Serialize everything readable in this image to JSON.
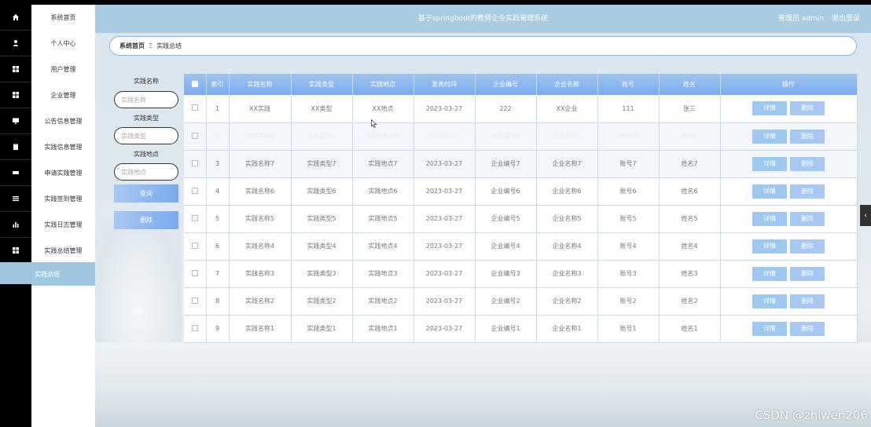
{
  "header": {
    "title": "基于springboot的教师企业实践管理系统",
    "user": "管理员 admin",
    "logout": "退出登录"
  },
  "breadcrumb": {
    "home": "系统首页",
    "separator": "Ξ",
    "current": "实践总结"
  },
  "sidebar": {
    "items": [
      {
        "label": "系统首页",
        "icon": "home-icon"
      },
      {
        "label": "个人中心",
        "icon": "user-icon"
      },
      {
        "label": "用户管理",
        "icon": "grid-icon"
      },
      {
        "label": "企业管理",
        "icon": "grid-icon"
      },
      {
        "label": "公告信息管理",
        "icon": "monitor-icon"
      },
      {
        "label": "实践信息管理",
        "icon": "clipboard-icon"
      },
      {
        "label": "申请实践管理",
        "icon": "ticket-icon"
      },
      {
        "label": "实践签到管理",
        "icon": "list-icon"
      },
      {
        "label": "实践日志管理",
        "icon": "bar-chart-icon"
      },
      {
        "label": "实践总结管理",
        "icon": "grid-icon"
      }
    ],
    "active": {
      "label": "实践总结"
    }
  },
  "filters": {
    "name_label": "实践名称",
    "name_placeholder": "实践名称",
    "type_label": "实践类型",
    "type_placeholder": "实践类型",
    "place_label": "实践地点",
    "place_placeholder": "实践地点",
    "query_button": "查询",
    "delete_button": "删除"
  },
  "table": {
    "columns": [
      "索引",
      "实践名称",
      "实践类型",
      "实践地点",
      "发表时间",
      "企业编号",
      "企业名称",
      "账号",
      "姓名",
      "操作"
    ],
    "detail_label": "详情",
    "delete_label": "删除",
    "rows": [
      {
        "index": "1",
        "name": "XX实践",
        "type": "XX类型",
        "place": "XX地点",
        "time": "2023-03-27",
        "company_no": "222",
        "company": "XX企业",
        "account": "111",
        "person": "张三"
      },
      {
        "index": "2",
        "name": "实践名称8",
        "type": "实践类型8",
        "place": "实践地点8",
        "time": "2023-03-27",
        "company_no": "企业编号8",
        "company": "企业名称8",
        "account": "账号8",
        "person": "姓名8"
      },
      {
        "index": "3",
        "name": "实践名称7",
        "type": "实践类型7",
        "place": "实践地点7",
        "time": "2023-03-27",
        "company_no": "企业编号7",
        "company": "企业名称7",
        "account": "账号7",
        "person": "姓名7"
      },
      {
        "index": "4",
        "name": "实践名称6",
        "type": "实践类型6",
        "place": "实践地点6",
        "time": "2023-03-27",
        "company_no": "企业编号6",
        "company": "企业名称6",
        "account": "账号6",
        "person": "姓名6"
      },
      {
        "index": "5",
        "name": "实践名称5",
        "type": "实践类型5",
        "place": "实践地点5",
        "time": "2023-03-27",
        "company_no": "企业编号5",
        "company": "企业名称5",
        "account": "账号5",
        "person": "姓名5"
      },
      {
        "index": "6",
        "name": "实践名称4",
        "type": "实践类型4",
        "place": "实践地点4",
        "time": "2023-03-27",
        "company_no": "企业编号4",
        "company": "企业名称4",
        "account": "账号4",
        "person": "姓名4"
      },
      {
        "index": "7",
        "name": "实践名称3",
        "type": "实践类型3",
        "place": "实践地点3",
        "time": "2023-03-27",
        "company_no": "企业编号3",
        "company": "企业名称3",
        "account": "账号3",
        "person": "姓名3"
      },
      {
        "index": "8",
        "name": "实践名称2",
        "type": "实践类型2",
        "place": "实践地点2",
        "time": "2023-03-27",
        "company_no": "企业编号2",
        "company": "企业名称2",
        "account": "账号2",
        "person": "姓名2"
      },
      {
        "index": "9",
        "name": "实践名称1",
        "type": "实践类型1",
        "place": "实践地点1",
        "time": "2023-03-27",
        "company_no": "企业编号1",
        "company": "企业名称1",
        "account": "账号1",
        "person": "姓名1"
      }
    ]
  },
  "watermark": "CSDN @zhiwen206"
}
